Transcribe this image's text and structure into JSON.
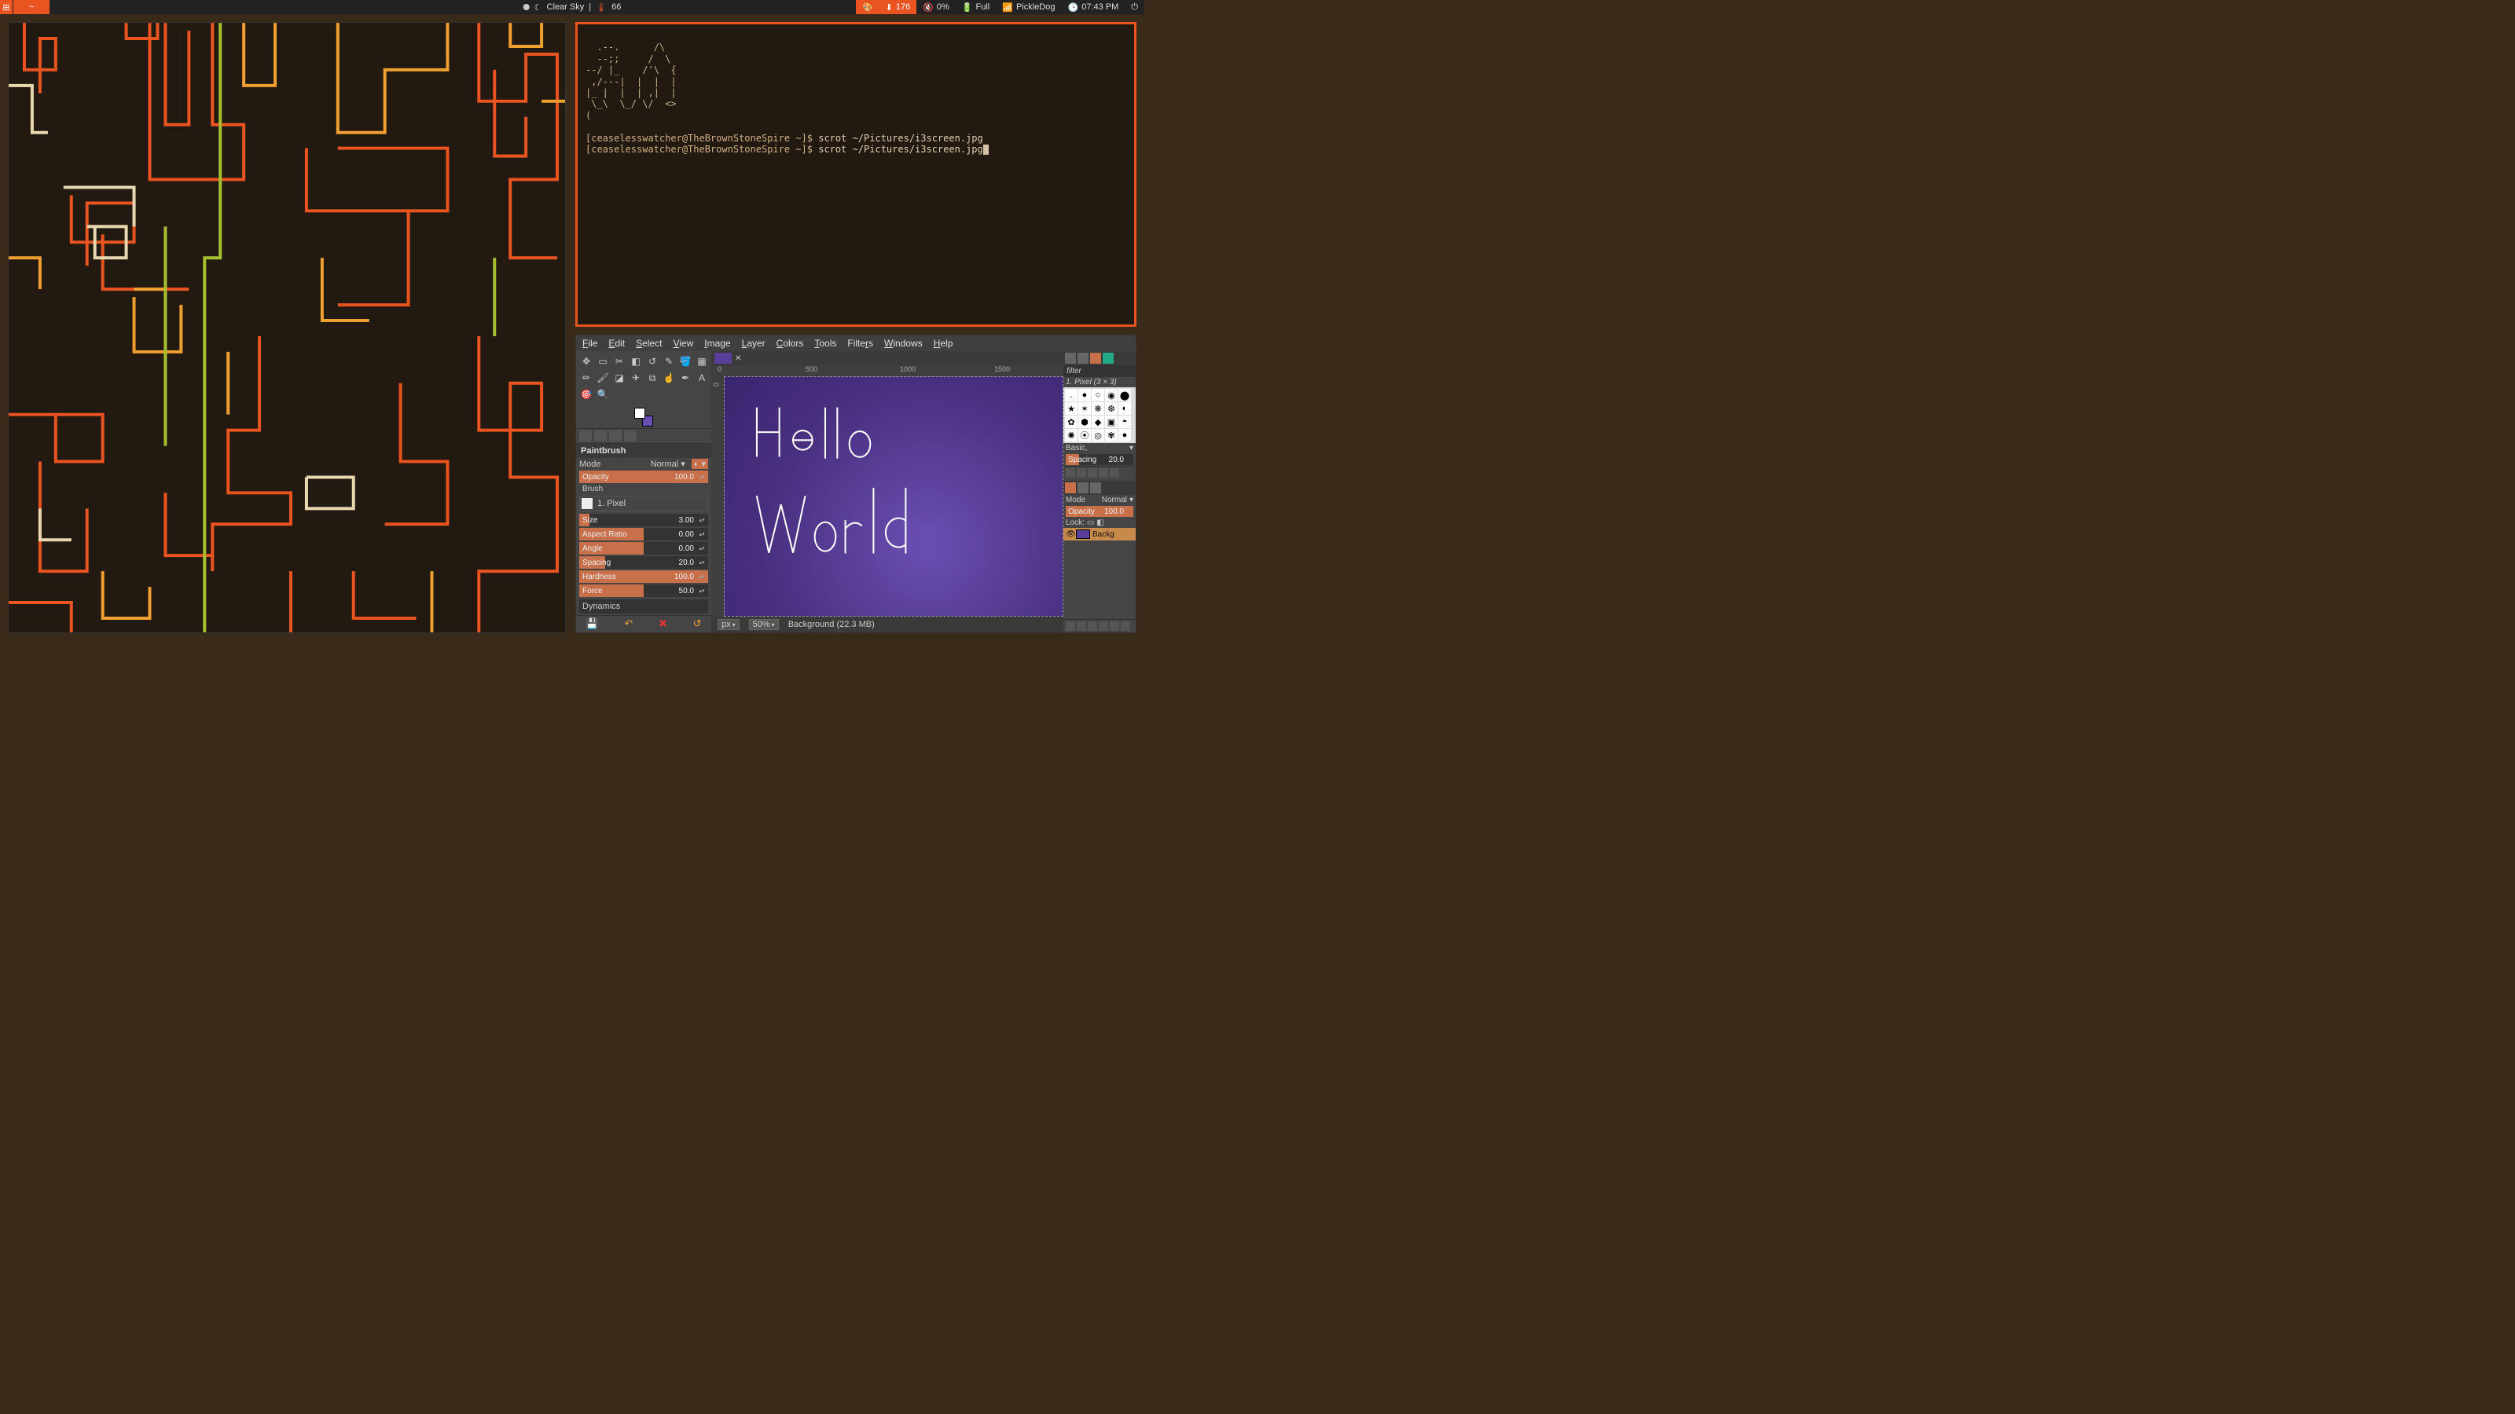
{
  "topbar": {
    "workspace": "⊞",
    "title": "~",
    "weather_icon": "☾",
    "weather": "Clear Sky",
    "sep": "|",
    "temp_icon": "🌡",
    "temp": "66",
    "palette": "🎨",
    "updates_icon": "⬇",
    "updates": "176",
    "vol_icon": "🔇",
    "volume": "0%",
    "bat_icon": "🔋",
    "battery": "Full",
    "net_icon": "📶",
    "network": "PickleDog",
    "clock_icon": "🕒",
    "time": "07:43 PM",
    "power": "⏻"
  },
  "terminal": {
    "ascii": "  .--.      /\\\n  --;;     /  \\\n--/ |_    /'\\  {\n ,/---|  |  |  |\n|_ |  |  | ,|  |\n \\_\\  \\_/ \\/  <>\n(",
    "prompt1_user": "[ceaselesswatcher@TheBrownStoneSpire ~]$",
    "prompt1_cmd": "scrot ~/Pictures/i3screen.jpg",
    "prompt2_user": "[ceaselesswatcher@TheBrownStoneSpire ~]$",
    "prompt2_cmd": "scrot ~/Pictures/i3screen.jpg"
  },
  "gimp": {
    "menus": [
      "File",
      "Edit",
      "Select",
      "View",
      "Image",
      "Layer",
      "Colors",
      "Tools",
      "Filters",
      "Windows",
      "Help"
    ],
    "tool_title": "Paintbrush",
    "mode_label": "Mode",
    "mode_value": "Normal",
    "opacity_label": "Opacity",
    "opacity_value": "100.0",
    "brush_label": "Brush",
    "brush_name": "1. Pixel",
    "size_label": "Size",
    "size_value": "3.00",
    "aspect_label": "Aspect Ratio",
    "aspect_value": "0.00",
    "angle_label": "Angle",
    "angle_value": "0.00",
    "spacing_label": "Spacing",
    "spacing_value": "20.0",
    "hardness_label": "Hardness",
    "hardness_value": "100.0",
    "force_label": "Force",
    "force_value": "50.0",
    "dynamics_label": "Dynamics",
    "ruler_ticks_h": [
      "0",
      "500",
      "1000",
      "1500"
    ],
    "ruler_ticks_v": [
      "0"
    ],
    "canvas_text1": "Hello",
    "canvas_text2": "World",
    "unit": "px",
    "zoom": "50%",
    "status": "Background (22.3 MB)",
    "right": {
      "filter_label": "filter",
      "brush_title": "1. Pixel (3 × 3)",
      "preset_label": "Basic,",
      "spacing_label": "Spacing",
      "spacing_value": "20.0",
      "mode_label": "Mode",
      "normal_label": "Normal",
      "opacity_label": "Opacity",
      "opacity_value": "100.0",
      "lock_label": "Lock:",
      "layer_name": "Backg"
    }
  }
}
